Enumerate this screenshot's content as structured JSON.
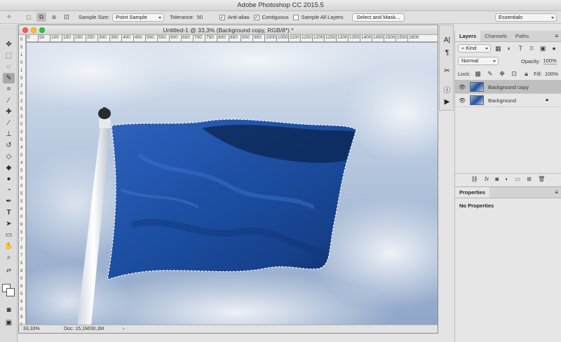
{
  "window": {
    "title": "Adobe Photoshop CC 2015.5"
  },
  "options": {
    "sample_size_label": "Sample Size:",
    "sample_size_value": "Point Sample",
    "tolerance_label": "Tolerance:",
    "tolerance_value": "50",
    "anti_alias_label": "Anti-alias",
    "anti_alias_checked": true,
    "contiguous_label": "Contiguous",
    "contiguous_checked": true,
    "sample_all_layers_label": "Sample All Layers",
    "sample_all_layers_checked": false,
    "select_mask_label": "Select and Mask...",
    "workspace_value": "Essentials"
  },
  "document": {
    "title": "Untitled-1 @ 33,3% (Background copy, RGB/8*) *",
    "zoom": "33,33%",
    "doc_size": "Doc: 15,1M/30,3M",
    "ruler_h": [
      "0",
      "50",
      "100",
      "150",
      "200",
      "250",
      "300",
      "350",
      "400",
      "450",
      "500",
      "550",
      "600",
      "650",
      "700",
      "750",
      "800",
      "850",
      "900",
      "950",
      "1000",
      "1050",
      "1100",
      "1150",
      "1200",
      "1250",
      "1300",
      "1350",
      "1400",
      "1450",
      "1500",
      "1550",
      "1600"
    ],
    "ruler_v": [
      "0",
      "5",
      "1",
      "0",
      "1",
      "5",
      "2",
      "0",
      "2",
      "5",
      "3",
      "0",
      "3",
      "5",
      "4",
      "0",
      "4",
      "5",
      "5",
      "0",
      "5",
      "5",
      "6",
      "0",
      "6",
      "5",
      "7",
      "0",
      "7",
      "5",
      "8",
      "0",
      "8",
      "5",
      "9",
      "0",
      "9",
      "5"
    ]
  },
  "layers_panel": {
    "tabs": [
      "Layers",
      "Channels",
      "Paths"
    ],
    "filter_value": "Kind",
    "blend_mode": "Normal",
    "opacity_label": "Opacity:",
    "opacity_value": "100%",
    "lock_label": "Lock:",
    "fill_label": "Fill:",
    "fill_value": "100%",
    "layers": [
      {
        "name": "Background copy",
        "selected": true,
        "visible": true,
        "locked": false
      },
      {
        "name": "Background",
        "selected": false,
        "visible": true,
        "locked": true
      }
    ]
  },
  "properties_panel": {
    "title": "Properties",
    "content": "No Properties"
  },
  "colors": {
    "accent_selected": "#bfbfbf",
    "flag_blue": "#1c4fa3",
    "sky": "#b9cbe0"
  }
}
